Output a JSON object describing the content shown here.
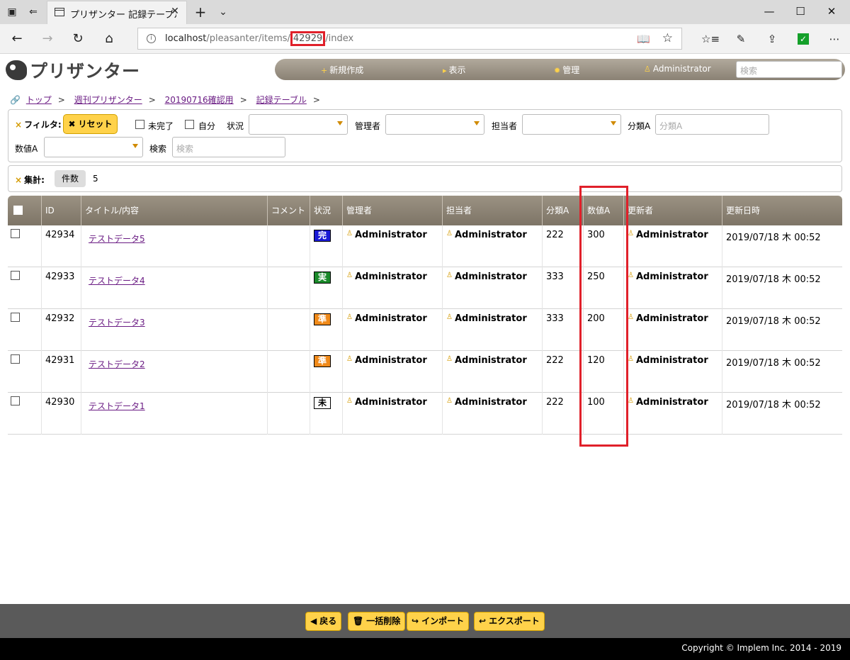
{
  "browser": {
    "tab_title": "プリザンター 記録テーブル ‡",
    "url_host": "localhost",
    "url_pre": "/pleasanter/items/",
    "url_id": "42929",
    "url_post": "/index"
  },
  "header": {
    "logo_text": "プリザンター",
    "menu": [
      {
        "label": "新規作成",
        "icon": "plus-icon"
      },
      {
        "label": "表示",
        "icon": "caret-right-icon"
      },
      {
        "label": "管理",
        "icon": "gear-icon"
      },
      {
        "label": "Administrator",
        "icon": "user-icon"
      }
    ],
    "search_placeholder": "検索"
  },
  "breadcrumb": [
    "トップ",
    "週刊プリザンター",
    "20190716確認用",
    "記録テーブル"
  ],
  "breadcrumb_sep": ">",
  "filter": {
    "title": "フィルタ:",
    "reset_label": "リセット",
    "incomplete_label": "未完了",
    "self_label": "自分",
    "status_label": "状況",
    "manager_label": "管理者",
    "owner_label": "担当者",
    "class_a_label": "分類A",
    "class_a_placeholder": "分類A",
    "num_a_label": "数値A",
    "search_label": "検索",
    "search_placeholder": "検索"
  },
  "aggregate": {
    "title": "集計:",
    "count_label": "件数",
    "count_value": "5"
  },
  "grid": {
    "columns": [
      "ID",
      "タイトル/内容",
      "コメント",
      "状況",
      "管理者",
      "担当者",
      "分類A",
      "数値A",
      "更新者",
      "更新日時"
    ],
    "rows": [
      {
        "id": "42934",
        "title": "テストデータ5",
        "status": "完",
        "status_bg": "#1a1ad6",
        "status_fg": "#ffffff",
        "manager": "Administrator",
        "owner": "Administrator",
        "class_a": "222",
        "num_a": "300",
        "updater": "Administrator",
        "updated": "2019/07/18 木 00:52"
      },
      {
        "id": "42933",
        "title": "テストデータ4",
        "status": "実",
        "status_bg": "#1a8a2a",
        "status_fg": "#ffffff",
        "manager": "Administrator",
        "owner": "Administrator",
        "class_a": "333",
        "num_a": "250",
        "updater": "Administrator",
        "updated": "2019/07/18 木 00:52"
      },
      {
        "id": "42932",
        "title": "テストデータ3",
        "status": "準",
        "status_bg": "#f08a1a",
        "status_fg": "#ffffff",
        "manager": "Administrator",
        "owner": "Administrator",
        "class_a": "333",
        "num_a": "200",
        "updater": "Administrator",
        "updated": "2019/07/18 木 00:52"
      },
      {
        "id": "42931",
        "title": "テストデータ2",
        "status": "準",
        "status_bg": "#f08a1a",
        "status_fg": "#ffffff",
        "manager": "Administrator",
        "owner": "Administrator",
        "class_a": "222",
        "num_a": "120",
        "updater": "Administrator",
        "updated": "2019/07/18 木 00:52"
      },
      {
        "id": "42930",
        "title": "テストデータ1",
        "status": "未",
        "status_bg": "#ffffff",
        "status_fg": "#000000",
        "manager": "Administrator",
        "owner": "Administrator",
        "class_a": "222",
        "num_a": "100",
        "updater": "Administrator",
        "updated": "2019/07/18 木 00:52"
      }
    ]
  },
  "footer": {
    "buttons": [
      {
        "label": "戻る",
        "icon": "back-icon"
      },
      {
        "label": "一括削除",
        "icon": "trash-icon"
      },
      {
        "label": "インポート",
        "icon": "import-icon"
      },
      {
        "label": "エクスポート",
        "icon": "export-icon"
      }
    ],
    "copyright": "Copyright © Implem Inc. 2014 - 2019"
  },
  "colors": {
    "accent": "#ffd24a",
    "highlight": "#e0202a",
    "link": "#6a1b83"
  }
}
